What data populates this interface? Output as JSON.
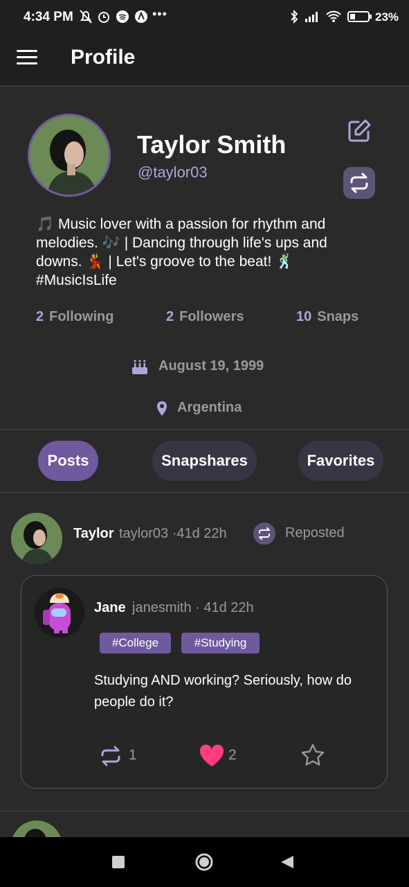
{
  "status_bar": {
    "time": "4:34 PM",
    "battery": "23%"
  },
  "app_bar": {
    "title": "Profile"
  },
  "profile": {
    "name": "Taylor Smith",
    "handle": "@taylor03",
    "bio": "🎵 Music lover with a passion for rhythm and melodies. 🎶 | Dancing through life's ups and downs. 💃 | Let's groove to the beat! 🕺 #MusicIsLife",
    "stats": [
      {
        "count": "2",
        "label": "Following"
      },
      {
        "count": "2",
        "label": "Followers"
      },
      {
        "count": "10",
        "label": "Snaps"
      }
    ],
    "birthday": "August 19, 1999",
    "location": "Argentina"
  },
  "tabs": [
    "Posts",
    "Snapshares",
    "Favorites"
  ],
  "post": {
    "author": "Taylor",
    "meta": "taylor03 ·41d 22h",
    "repost_label": "Reposted",
    "inner": {
      "author": "Jane",
      "meta": "janesmith · 41d 22h",
      "tags": [
        "#College",
        "#Studying"
      ],
      "text": "Studying AND working? Seriously, how do people do it?",
      "reposts": "1",
      "likes": "2"
    }
  },
  "colors": {
    "accent": "#6f5a9e",
    "accent_light": "#b3a3d9",
    "heart": "#ff3d7f",
    "background": "#2a2a2a"
  }
}
